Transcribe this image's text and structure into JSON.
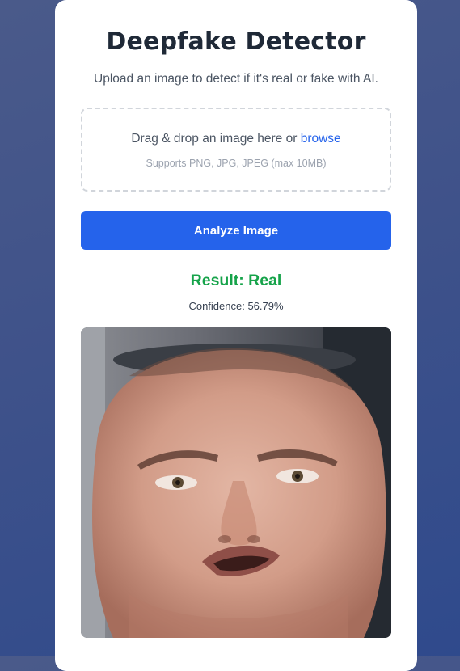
{
  "app": {
    "title": "Deepfake Detector",
    "subtitle": "Upload an image to detect if it's real or fake with AI."
  },
  "dropzone": {
    "text_before": "Drag & drop an image here or ",
    "browse_link": "browse",
    "hint": "Supports PNG, JPG, JPEG (max 10MB)"
  },
  "actions": {
    "analyze_label": "Analyze Image"
  },
  "result": {
    "label": "Result: Real",
    "confidence": "Confidence: 56.79%",
    "status_color": "#16a34a"
  },
  "colors": {
    "primary": "#2563eb",
    "text_dark": "#1f2937",
    "text_muted": "#4b5563",
    "hint": "#9ca3af"
  }
}
